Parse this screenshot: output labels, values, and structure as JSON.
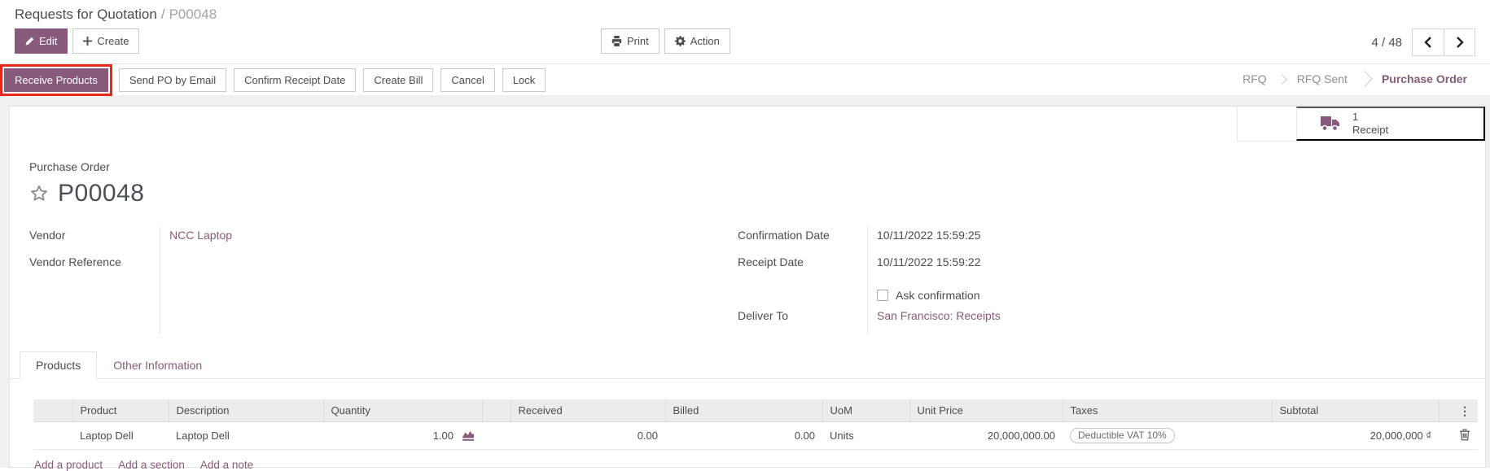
{
  "breadcrumb": {
    "parent": "Requests for Quotation",
    "separator": "/",
    "current": "P00048"
  },
  "control_panel": {
    "edit_label": "Edit",
    "create_label": "Create",
    "print_label": "Print",
    "action_label": "Action",
    "pager_value": "4 / 48"
  },
  "statusbar": {
    "receive_products_label": "Receive Products",
    "send_po_label": "Send PO by Email",
    "confirm_receipt_label": "Confirm Receipt Date",
    "create_bill_label": "Create Bill",
    "cancel_label": "Cancel",
    "lock_label": "Lock",
    "steps": [
      {
        "label": "RFQ",
        "active": false
      },
      {
        "label": "RFQ Sent",
        "active": false
      },
      {
        "label": "Purchase Order",
        "active": true
      }
    ]
  },
  "smart_button": {
    "count": "1",
    "label": "Receipt",
    "icon": "truck-icon"
  },
  "sheet": {
    "doc_type_label": "Purchase Order",
    "doc_name": "P00048",
    "vendor_label": "Vendor",
    "vendor_value": "NCC Laptop",
    "vendor_ref_label": "Vendor Reference",
    "vendor_ref_value": "",
    "confirmation_date_label": "Confirmation Date",
    "confirmation_date_value": "10/11/2022 15:59:25",
    "receipt_date_label": "Receipt Date",
    "receipt_date_value": "10/11/2022 15:59:22",
    "ask_confirmation_label": "Ask confirmation",
    "ask_confirmation_checked": false,
    "deliver_to_label": "Deliver To",
    "deliver_to_value": "San Francisco: Receipts",
    "tabs": [
      {
        "label": "Products",
        "active": true
      },
      {
        "label": "Other Information",
        "active": false
      }
    ]
  },
  "products_table": {
    "headers": [
      "Product",
      "Description",
      "Quantity",
      "",
      "Received",
      "Billed",
      "UoM",
      "Unit Price",
      "Taxes",
      "Subtotal"
    ],
    "rows": [
      {
        "product": "Laptop Dell",
        "description": "Laptop Dell",
        "quantity": "1.00",
        "received": "0.00",
        "billed": "0.00",
        "uom": "Units",
        "unit_price": "20,000,000.00",
        "taxes": "Deductible VAT 10%",
        "subtotal": "20,000,000 ₫"
      }
    ],
    "add_product_label": "Add a product",
    "add_section_label": "Add a section",
    "add_note_label": "Add a note"
  },
  "colors": {
    "accent": "#875A7B",
    "annotation_red": "#e8271b",
    "link": "#875A7B",
    "muted_text": "#8f8f8f",
    "body_text": "#4c4c4c",
    "table_header_bg": "#ececec"
  }
}
